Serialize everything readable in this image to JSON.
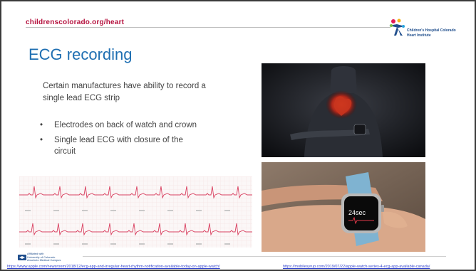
{
  "header": {
    "url": "childrenscolorado.org/heart",
    "logo_text": [
      "Children's Hospital Colorado",
      "Heart Institute"
    ]
  },
  "slide": {
    "title": "ECG recording",
    "intro": "Certain manufactures have ability to record a single lead ECG strip",
    "bullets": [
      "Electrodes on back of watch and crown",
      "Single lead ECG with closure of the circuit"
    ]
  },
  "images": {
    "watch_readout": "24sec"
  },
  "footer": {
    "affiliation": [
      "Affiliated with",
      "University of Colorado",
      "Anschutz Medical Campus"
    ],
    "source_left": "https://www.apple.com/newsroom/2018/12/ecg-app-and-irregular-heart-rhythm-notification-available-today-on-apple-watch/",
    "source_right": "https://mobilesyrup.com/2019/07/22/apple-watch-series-4-ecg-app-available-canada/"
  },
  "colors": {
    "brand_red": "#b5123e",
    "title_blue": "#1f6fb2",
    "ecg_trace": "#d94060",
    "link_blue": "#3344cc"
  }
}
